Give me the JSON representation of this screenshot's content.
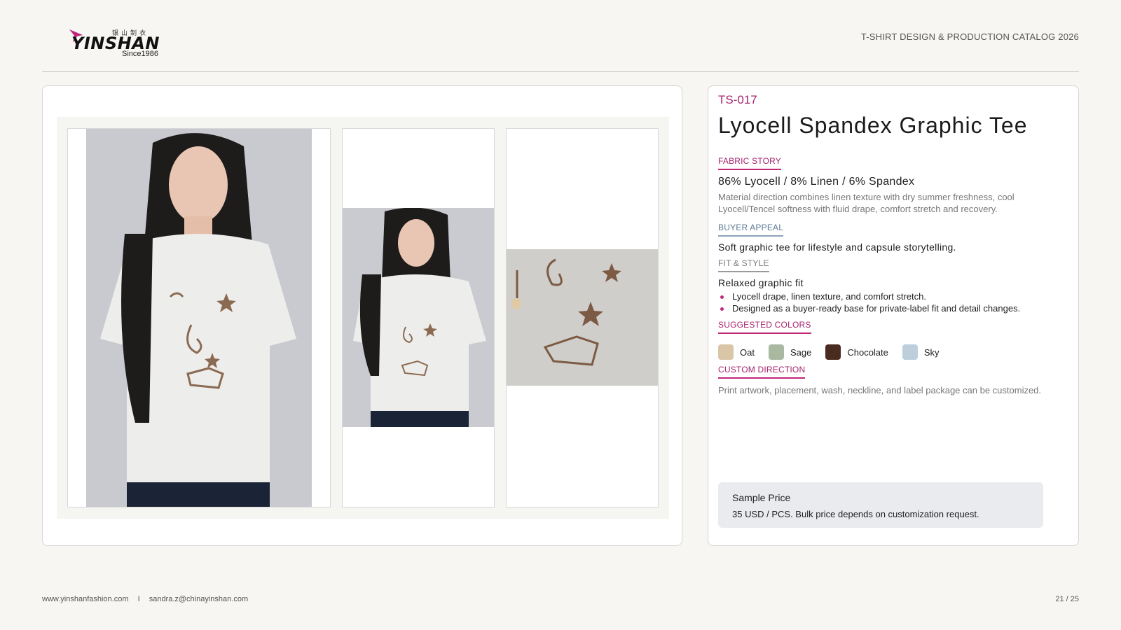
{
  "brand": {
    "chinese_name": "银山制衣",
    "wordmark": "YINSHAN",
    "since": "Since1986",
    "accent_color": "#c0287c"
  },
  "header": {
    "catalog_title": "T-SHIRT DESIGN & PRODUCTION CATALOG 2026"
  },
  "gallery": {
    "images": [
      {
        "icon": "model-front-photo"
      },
      {
        "icon": "model-three-quarter-photo"
      },
      {
        "icon": "print-closeup-photo"
      }
    ]
  },
  "product": {
    "code": "TS-017",
    "title": "Lyocell Spandex Graphic Tee",
    "fabric_story": {
      "label": "FABRIC STORY",
      "composition": "86% Lyocell / 8% Linen / 6% Spandex",
      "description": "Material direction combines linen texture with dry summer freshness, cool Lyocell/Tencel softness with fluid drape, comfort stretch and recovery."
    },
    "buyer_appeal": {
      "label": "BUYER APPEAL",
      "text": "Soft graphic tee for lifestyle and capsule storytelling."
    },
    "fit_style": {
      "label": "FIT & STYLE",
      "fit": "Relaxed graphic fit",
      "bullets": [
        "Lyocell drape, linen texture, and comfort stretch.",
        "Designed as a buyer-ready base for private-label fit and detail changes."
      ]
    },
    "colors": {
      "label": "SUGGESTED COLORS",
      "items": [
        {
          "name": "Oat",
          "hex": "#d8c6a6"
        },
        {
          "name": "Sage",
          "hex": "#a9b9a1"
        },
        {
          "name": "Chocolate",
          "hex": "#4a2b20"
        },
        {
          "name": "Sky",
          "hex": "#bccfdb"
        }
      ]
    },
    "custom_direction": {
      "label": "CUSTOM DIRECTION",
      "text": "Print artwork, placement, wash, neckline, and label package can be customized."
    },
    "price": {
      "label": "Sample Price",
      "value": "35 USD / PCS. Bulk price depends on customization request."
    }
  },
  "footer": {
    "website": "www.yinshanfashion.com",
    "separator": "I",
    "email": "sandra.z@chinayinshan.com",
    "page": "21 / 25"
  }
}
